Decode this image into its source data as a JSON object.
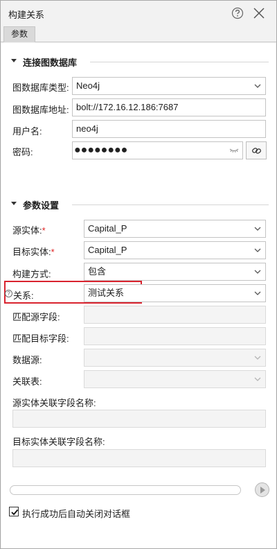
{
  "window": {
    "title": "构建关系"
  },
  "tabs": [
    {
      "label": "参数"
    }
  ],
  "section_db": {
    "title": "连接图数据库",
    "db_type_label": "图数据库类型:",
    "db_type_value": "Neo4j",
    "db_address_label": "图数据库地址:",
    "db_address_value": "bolt://172.16.12.186:7687",
    "username_label": "用户名:",
    "username_value": "neo4j",
    "password_label": "密码:",
    "password_mask": "●●●●●●●●"
  },
  "section_params": {
    "title": "参数设置",
    "source_entity_label": "源实体:",
    "source_entity_value": "Capital_P",
    "target_entity_label": "目标实体:",
    "target_entity_value": "Capital_P",
    "build_method_label": "构建方式:",
    "build_method_value": "包含",
    "relation_label": "关系:",
    "relation_value": "测试关系",
    "match_source_field_label": "匹配源字段:",
    "match_target_field_label": "匹配目标字段:",
    "datasource_label": "数据源:",
    "link_table_label": "关联表:",
    "source_link_field_label": "源实体关联字段名称:",
    "target_link_field_label": "目标实体关联字段名称:"
  },
  "required_mark": "*",
  "help_mark": "?",
  "footer": {
    "progress": 0,
    "auto_close_label": "执行成功后自动关闭对话框",
    "auto_close_checked": true
  },
  "icons": {
    "help": "help-circle-icon",
    "close": "close-icon",
    "dropdown": "chevron-down-icon",
    "reveal_password": "eye-closed-icon",
    "test_connection": "link-icon",
    "run": "play-icon"
  },
  "colors": {
    "highlight_border": "#d9232e",
    "required": "#e02020"
  }
}
